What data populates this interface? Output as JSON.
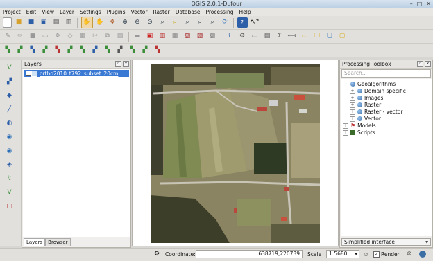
{
  "window": {
    "title": "QGIS 2.0.1-Dufour"
  },
  "menu": [
    "Project",
    "Edit",
    "View",
    "Layer",
    "Settings",
    "Plugins",
    "Vector",
    "Raster",
    "Database",
    "Processing",
    "Help"
  ],
  "layers_panel": {
    "title": "Layers",
    "layer_name": "ortho2010_t792_subset_20cm",
    "tabs": [
      "Layers",
      "Browser"
    ]
  },
  "toolbox": {
    "title": "Processing Toolbox",
    "search_placeholder": "Search...",
    "tree": [
      {
        "label": "Geoalgorithms",
        "level": 0,
        "expanded": true,
        "icon": "gear-icon"
      },
      {
        "label": "Domain specific",
        "level": 1,
        "icon": "globe-icon"
      },
      {
        "label": "Images",
        "level": 1,
        "icon": "globe-icon"
      },
      {
        "label": "Raster",
        "level": 1,
        "icon": "globe-icon"
      },
      {
        "label": "Raster - vector",
        "level": 1,
        "icon": "globe-icon"
      },
      {
        "label": "Vector",
        "level": 1,
        "icon": "globe-icon"
      },
      {
        "label": "Models",
        "level": 0,
        "icon": "models-icon"
      },
      {
        "label": "Scripts",
        "level": 0,
        "icon": "scripts-icon"
      }
    ],
    "mode": "Simplified interface"
  },
  "status": {
    "coordinate_label": "Coordinate:",
    "coordinate": "638719,220739",
    "scale_label": "Scale",
    "scale": "1:5680",
    "render_label": "Render"
  }
}
